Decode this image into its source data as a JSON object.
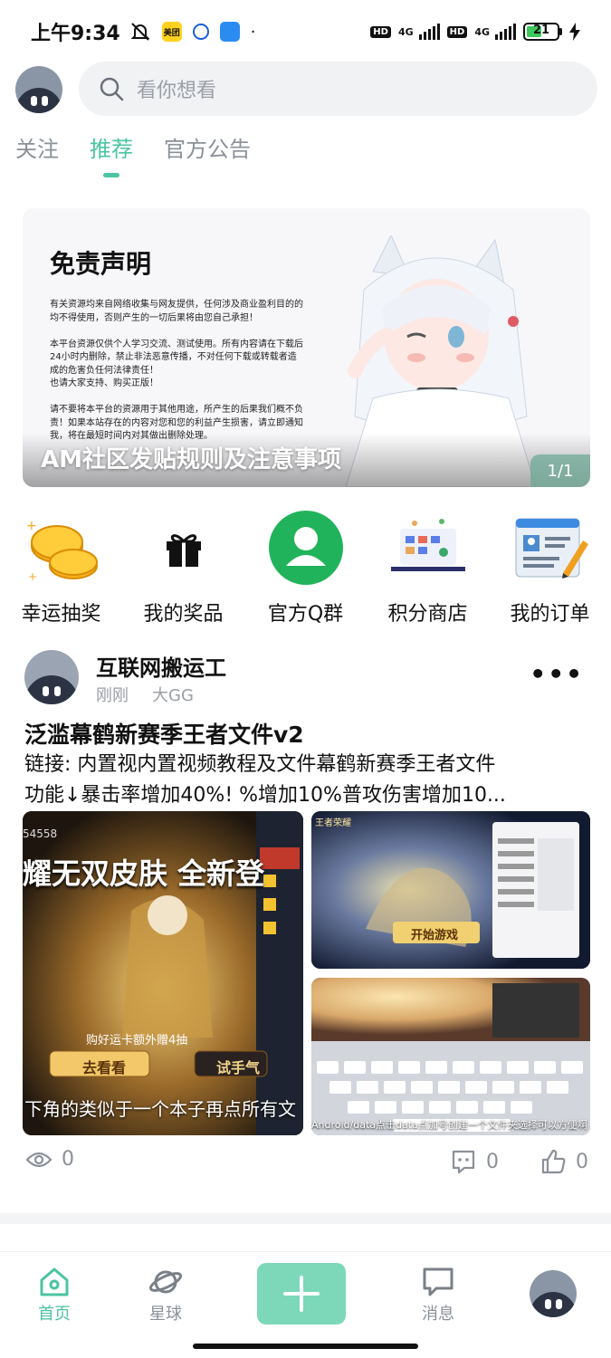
{
  "status_bar": {
    "time": "上午9:34",
    "app_badge_1": "美团",
    "net_1": "4G",
    "net_2": "4G",
    "hd": "HD",
    "battery": "21"
  },
  "header": {
    "search_placeholder": "看你想看"
  },
  "tabs": [
    {
      "label": "关注"
    },
    {
      "label": "推荐"
    },
    {
      "label": "官方公告"
    }
  ],
  "banner": {
    "disclaimer_title": "免责声明",
    "disclaimer_body": "有关资源均来自网络收集与网友提供，任何涉及商业盈利目的的均不得使用，否则产生的一切后果将由您自己承担！\n\n本平台资源仅供个人学习交流、测试使用。所有内容请在下载后24小时内删除，禁止非法恶意传播，不对任何下载或转载者造成的危害负任何法律责任！\n也请大家支持、购买正版！\n\n请不要将本平台的资源用于其他用途，所产生的后果我们概不负责！如果本站存在的内容对您和您的利益产生损害，请立即通知我，将在最短时间内对其做出删除处理。",
    "caption": "AM社区发贴规则及注意事项",
    "pager": "1/1"
  },
  "quick_entries": [
    {
      "label": "幸运抽奖",
      "icon": "coins-icon"
    },
    {
      "label": "我的奖品",
      "icon": "gift-icon"
    },
    {
      "label": "官方Q群",
      "icon": "group-user-icon"
    },
    {
      "label": "积分商店",
      "icon": "store-icon"
    },
    {
      "label": "我的订单",
      "icon": "order-icon"
    }
  ],
  "post": {
    "author": "互联网搬运工",
    "time": "刚刚",
    "level": "大GG",
    "title": "泛滥幕鹤新赛季王者文件v2",
    "body_line1": "链接: 内置视内置视频教程及文件幕鹤新赛季王者文件",
    "body_line2": "功能↓暴击率增加40%! %增加10%普攻伤害增加10...",
    "image_left_caption": "下角的类似于一个本子再点所有文",
    "image_left_banner": "耀无双皮肤 全新登",
    "image_left_btn1": "去看看",
    "image_left_btn2": "试手气",
    "image_left_gift": "购好运卡额外赠4抽",
    "image_left_score": "54558",
    "image_rt_btn": "开始游戏",
    "image_rt_title": "王者荣耀",
    "image_rb_caption": "Android/data点击data点加号创建一个文件夹选择可以方便啊",
    "views": "0",
    "comments": "0",
    "likes": "0"
  },
  "bottom_nav": [
    {
      "label": "首页"
    },
    {
      "label": "星球"
    },
    {
      "label": "消息"
    }
  ],
  "colors": {
    "accent": "#4bc4a2",
    "plus_button": "#7cd8b8"
  }
}
